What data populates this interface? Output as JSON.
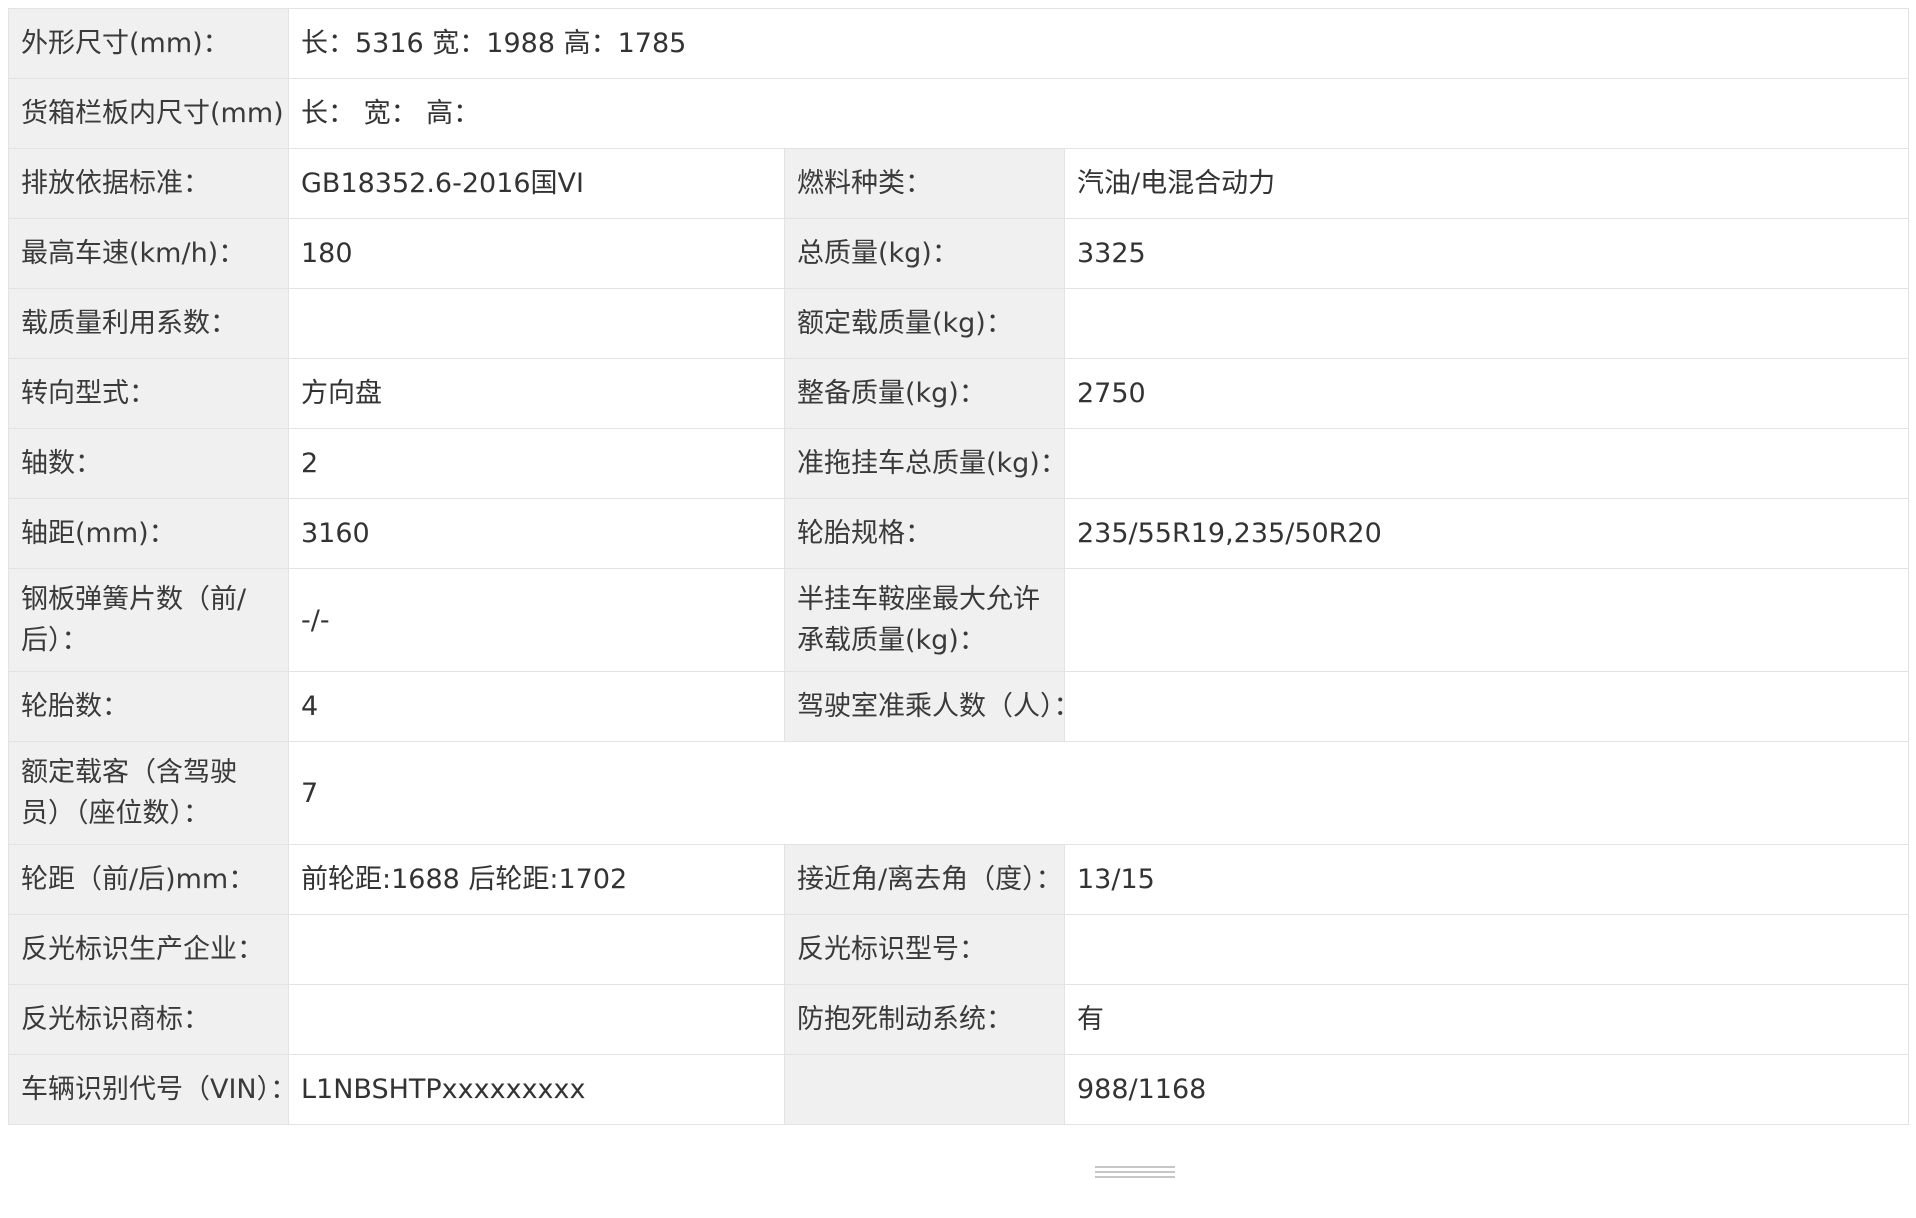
{
  "rows": [
    {
      "l1": "外形尺寸(mm)：",
      "v1": "长：5316 宽：1988 高：1785"
    },
    {
      "l1": "货箱栏板内尺寸(mm)：",
      "v1": "长：  宽：  高："
    },
    {
      "l1": "排放依据标准：",
      "v1": "GB18352.6-2016国VI",
      "l2": "燃料种类：",
      "v2": "汽油/电混合动力"
    },
    {
      "l1": "最高车速(km/h)：",
      "v1": "180",
      "l2": "总质量(kg)：",
      "v2": "3325"
    },
    {
      "l1": "载质量利用系数：",
      "v1": "",
      "l2": "额定载质量(kg)：",
      "v2": ""
    },
    {
      "l1": "转向型式：",
      "v1": "方向盘",
      "l2": "整备质量(kg)：",
      "v2": "2750"
    },
    {
      "l1": "轴数：",
      "v1": "2",
      "l2": "准拖挂车总质量(kg)：",
      "v2": ""
    },
    {
      "l1": "轴距(mm)：",
      "v1": "3160",
      "l2": "轮胎规格：",
      "v2": "235/55R19,235/50R20"
    },
    {
      "l1": "钢板弹簧片数（前/后）：",
      "v1": "-/-",
      "l2": "半挂车鞍座最大允许承载质量(kg)：",
      "v2": ""
    },
    {
      "l1": "轮胎数：",
      "v1": "4",
      "l2": "驾驶室准乘人数（人）：",
      "v2": ""
    },
    {
      "l1": "额定载客（含驾驶员）（座位数）：",
      "v1": "7"
    },
    {
      "l1": "轮距（前/后)mm：",
      "v1": "前轮距:1688 后轮距:1702",
      "l2": "接近角/离去角（度）：",
      "v2": "13/15"
    },
    {
      "l1": "反光标识生产企业：",
      "v1": "",
      "l2": "反光标识型号：",
      "v2": ""
    },
    {
      "l1": "反光标识商标：",
      "v1": "",
      "l2": "防抱死制动系统：",
      "v2": "有"
    },
    {
      "l1": "车辆识别代号（VIN）：",
      "v1": "L1NBSHTPxxxxxxxxx",
      "l2": "",
      "v2": "988/1168"
    }
  ]
}
